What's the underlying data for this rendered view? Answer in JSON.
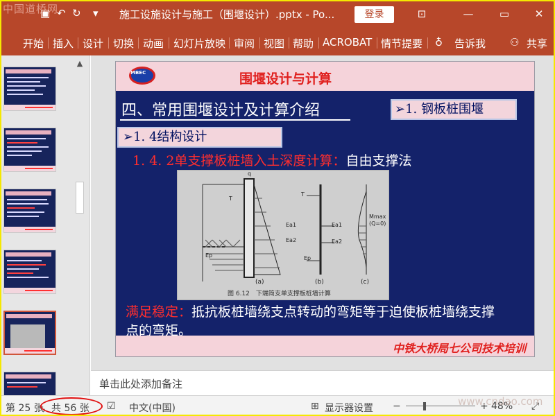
{
  "app": {
    "watermark_top": "中国道桥网",
    "title": "施工设施设计与施工（围堰设计）.pptx - Po...",
    "login_label": "登录",
    "qa_dropdown": "▾",
    "accent": "#b7472a"
  },
  "ribbon": {
    "tabs": [
      "开始",
      "插入",
      "设计",
      "切换",
      "动画",
      "幻灯片放映",
      "审阅",
      "视图",
      "帮助",
      "ACROBAT",
      "情节提要"
    ],
    "tell_me": "告诉我",
    "share": "共享"
  },
  "slide": {
    "header_title": "围堰设计与计算",
    "section_heading": "四、常用围堰设计及计算介绍",
    "topic_box": "➢1. 钢板桩围堰",
    "subtopic_box": "➢1. 4结构设计",
    "sub_heading_red": "1. 4. 2单支撑板桩墙入土深度计算：",
    "sub_heading_white": "自由支撑法",
    "figure_caption": "图 6.12　下端简支单支撑板桩墙计算",
    "figure_labels": {
      "q": "q",
      "t": "T",
      "ea1": "Ea1",
      "ea2": "Ea2",
      "ep": "Ep",
      "mmax": "Mmax",
      "q0": "(Q=0)",
      "a": "(a)",
      "b": "(b)",
      "c": "(c)"
    },
    "stability_label": "满足稳定：",
    "stability_text": "抵抗板桩墙绕支点转动的弯矩等于迫使板桩墙绕支撑点的弯矩。",
    "footer_text": "中铁大桥局七公司技术培训",
    "logo_text": "MBEC"
  },
  "notes": {
    "placeholder": "单击此处添加备注"
  },
  "status": {
    "slide_num": "第 25 张",
    "slide_total": "，共 56 张",
    "language": "中文(中国)",
    "display_settings": "显示器设置",
    "zoom_minus": "−",
    "zoom_plus": "+",
    "zoom": "48%",
    "watermark_bottom": "www.cndao.com"
  }
}
